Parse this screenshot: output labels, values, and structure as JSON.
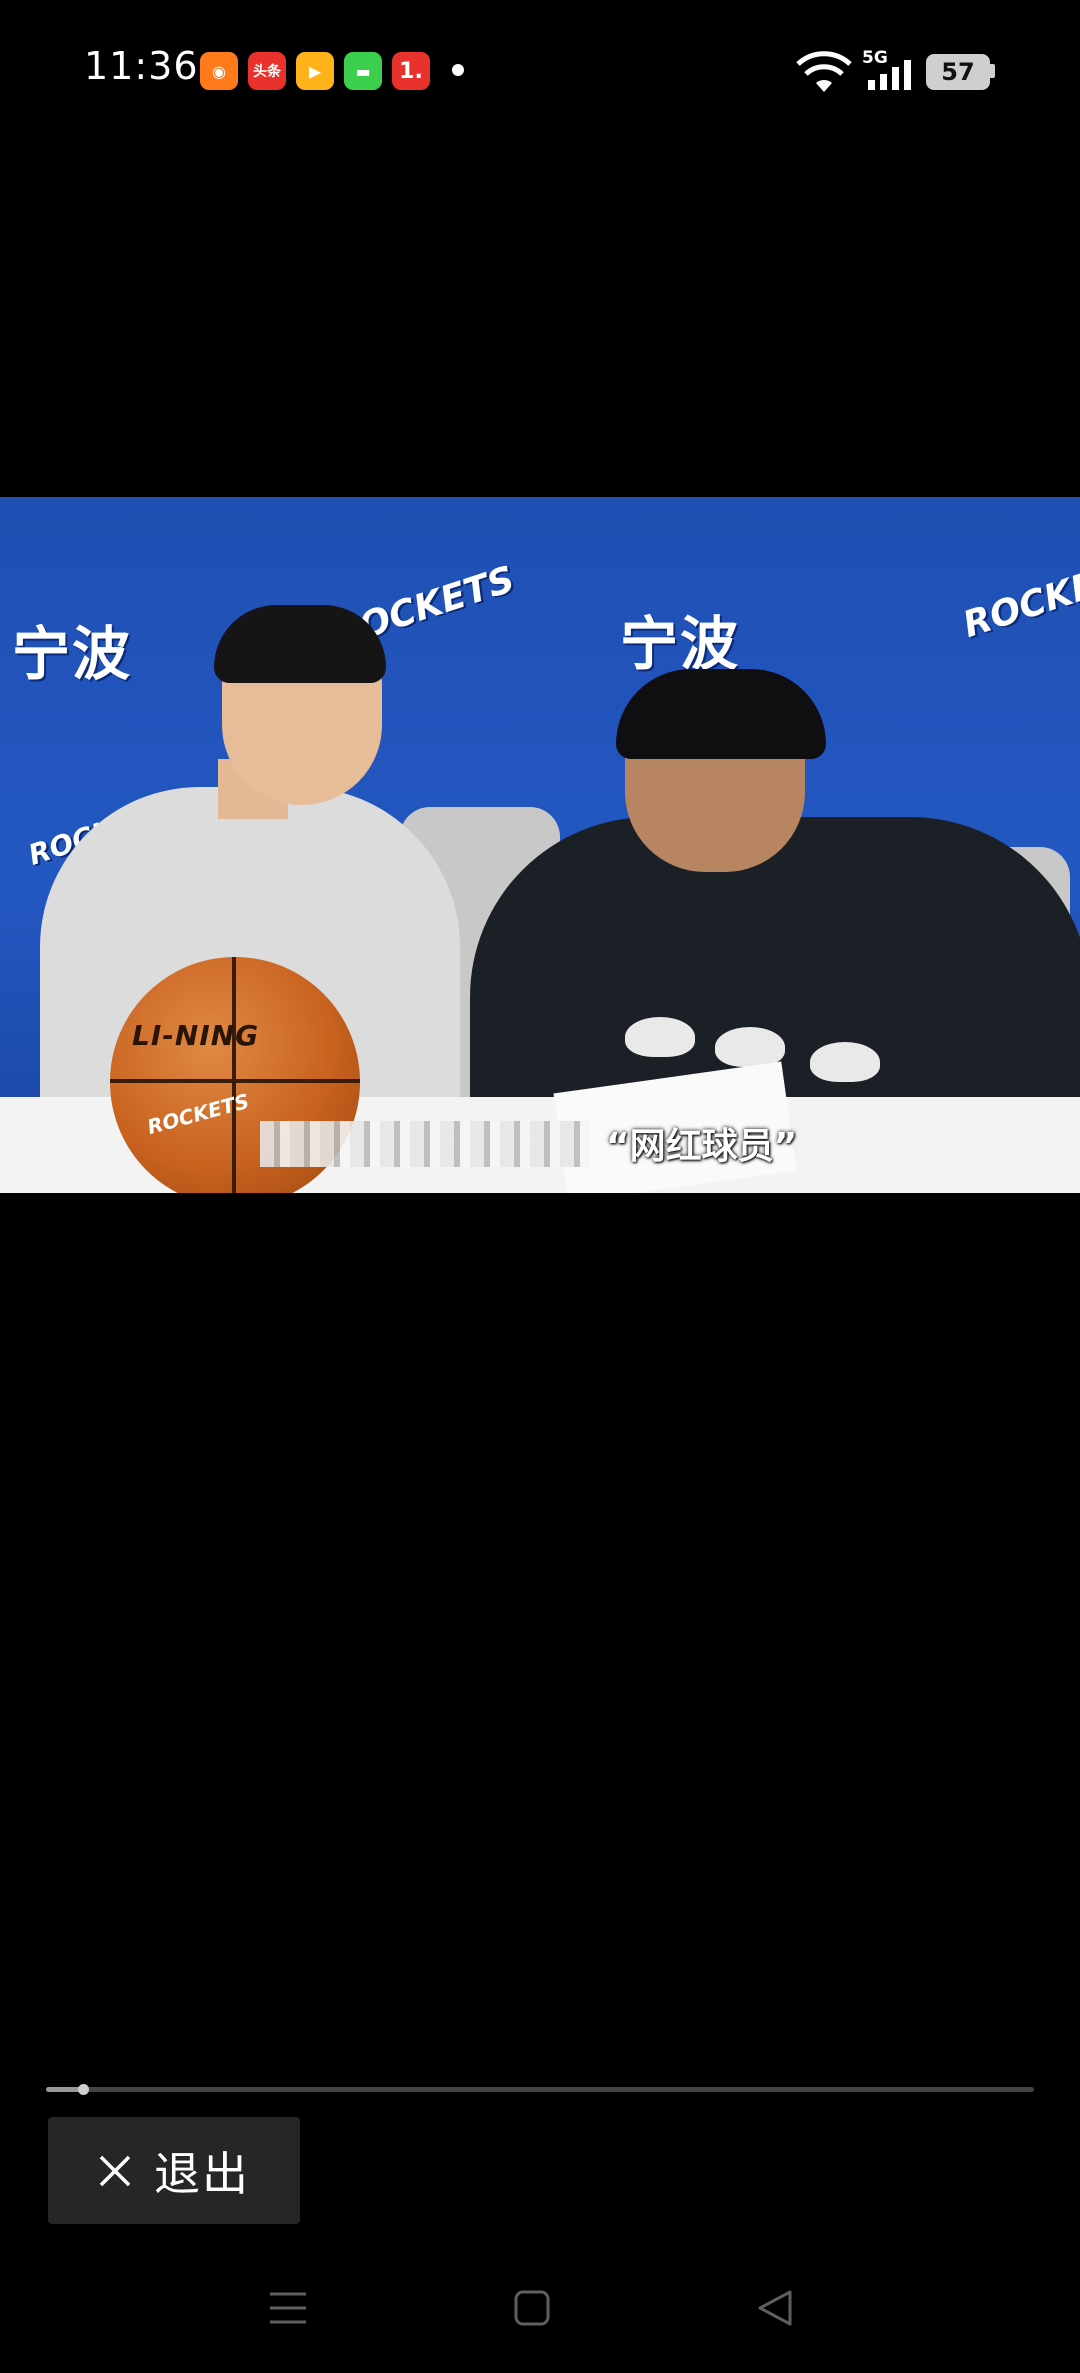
{
  "status_bar": {
    "time": "11:36",
    "notifications": [
      {
        "icon": "app-orange-icon",
        "label": "",
        "color": "#ff7a1a"
      },
      {
        "icon": "toutiao-icon",
        "label": "头条",
        "color": "#e8322b"
      },
      {
        "icon": "video-app-icon",
        "label": "",
        "color": "#ffb21a"
      },
      {
        "icon": "message-icon",
        "label": "",
        "color": "#3ccf4e"
      },
      {
        "icon": "app-red-icon",
        "label": "1.",
        "color": "#e8322b"
      }
    ],
    "network": "5G",
    "battery": "57"
  },
  "video": {
    "wall_text": "宁波",
    "wall_logo": "ROCKETS",
    "ball_brand": "LI-NING",
    "ball_logo": "ROCKETS",
    "subtitle": "“网红球员”"
  },
  "player": {
    "progress": 0.037,
    "exit_label": "退出"
  },
  "colors": {
    "background": "#000000",
    "exit_button_bg": "#262626",
    "progress_track": "#444444"
  }
}
